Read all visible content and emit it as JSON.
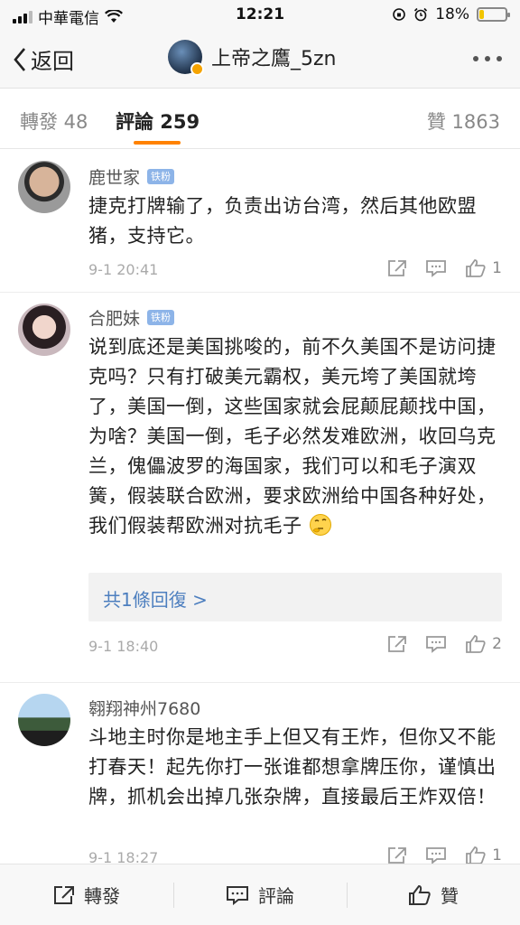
{
  "status_bar": {
    "carrier": "中華電信",
    "time": "12:21",
    "battery_percent": "18%",
    "battery_level": 0.18
  },
  "navbar": {
    "back_label": "返回",
    "title": "上帝之鷹_5zn"
  },
  "tabs": [
    {
      "label": "轉發 48",
      "active": false
    },
    {
      "label": "評論 259",
      "active": true
    },
    {
      "label": "贊 1863",
      "active": false
    }
  ],
  "accent_color": "#ff8200",
  "comments": [
    {
      "user": "鹿世家",
      "badge": "铁粉",
      "text": "捷克打牌输了，负责出访台湾，然后其他欧盟猪，支持它。",
      "time": "9-1 20:41",
      "likes": "1"
    },
    {
      "user": "合肥妹",
      "badge": "铁粉",
      "text": "说到底还是美国挑唆的，前不久美国不是访问捷克吗？只有打破美元霸权，美元垮了美国就垮了，美国一倒，这些国家就会屁颠屁颠找中国，为啥？美国一倒，毛子必然发难欧洲，收回乌克兰，傀儡波罗的海国家，我们可以和毛子演双簧，假装联合欧洲，要求欧洲给中国各种好处，我们假装帮欧洲对抗毛子",
      "emoji": "thinking-emoji",
      "replies_label": "共1條回復 >",
      "time": "9-1 18:40",
      "likes": "2"
    },
    {
      "user": "翱翔神州7680",
      "text": "斗地主时你是地主手上但又有王炸，但你又不能打春天！起先你打一张谁都想拿牌压你，谨慎出牌，抓机会出掉几张杂牌，直接最后王炸双倍！",
      "time": "9-1 18:27",
      "likes": "1"
    }
  ],
  "bottom_bar": {
    "repost_label": "轉發",
    "comment_label": "評論",
    "like_label": "贊"
  }
}
